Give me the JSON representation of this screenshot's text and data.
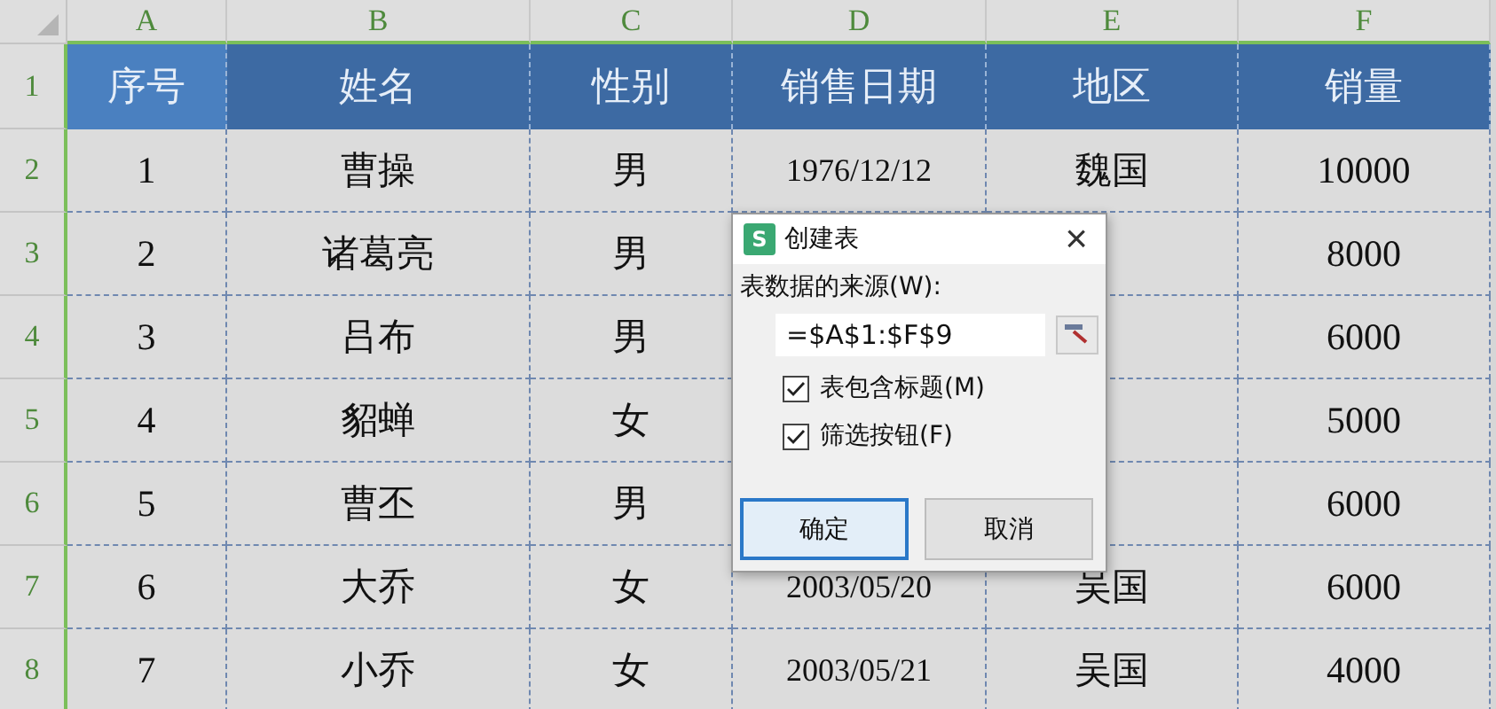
{
  "sheet": {
    "columns": [
      "A",
      "B",
      "C",
      "D",
      "E",
      "F"
    ],
    "row_numbers": [
      "1",
      "2",
      "3",
      "4",
      "5",
      "6",
      "7",
      "8"
    ],
    "header": [
      {
        "text": "序号",
        "selected": true
      },
      {
        "text": "姓名",
        "selected": false
      },
      {
        "text": "性别",
        "selected": false
      },
      {
        "text": "销售日期",
        "selected": false
      },
      {
        "text": "地区",
        "selected": false
      },
      {
        "text": "销量",
        "selected": false
      }
    ],
    "rows": [
      [
        "1",
        "曹操",
        "男",
        "1976/12/12",
        "魏国",
        "10000"
      ],
      [
        "2",
        "诸葛亮",
        "男",
        null,
        null,
        "8000"
      ],
      [
        "3",
        "吕布",
        "男",
        null,
        null,
        "6000"
      ],
      [
        "4",
        "貂蝉",
        "女",
        null,
        null,
        "5000"
      ],
      [
        "5",
        "曹丕",
        "男",
        null,
        null,
        "6000"
      ],
      [
        "6",
        "大乔",
        "女",
        "2003/05/20",
        "吴国",
        "6000"
      ],
      [
        "7",
        "小乔",
        "女",
        "2003/05/21",
        "吴国",
        "4000"
      ]
    ]
  },
  "dialog": {
    "app_badge": "S",
    "title": "创建表",
    "close": "×",
    "source_label": "表数据的来源(W):",
    "source_value": "=$A$1:$F$9",
    "options": [
      {
        "label": "表包含标题(M)",
        "checked": true
      },
      {
        "label": "筛选按钮(F)",
        "checked": true
      }
    ],
    "buttons": [
      {
        "label": "确定",
        "selected": true
      },
      {
        "label": "取消",
        "selected": false
      }
    ]
  }
}
